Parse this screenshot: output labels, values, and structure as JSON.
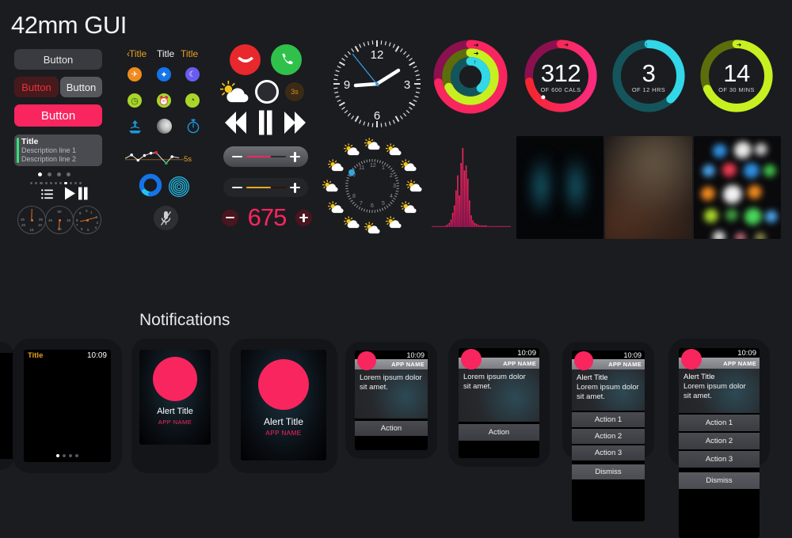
{
  "page": {
    "title": "42mm GUI",
    "notifications_title": "Notifications",
    "background": "#1b1c20",
    "accent_pink": "#f9255f",
    "accent_orange": "#e8a020"
  },
  "buttons": {
    "wide": "Button",
    "danger": "Button",
    "plain": "Button",
    "pink": "Button"
  },
  "description_card": {
    "title": "Title",
    "line1": "Description line 1",
    "line2": "Description line 2",
    "bar_color": "#36e07a"
  },
  "pager": {
    "big_dots": 4,
    "big_active": 0,
    "small_dots": 11,
    "small_active": 7
  },
  "media_small": {
    "list_icon": "list-icon",
    "play_icon": "play-icon",
    "pause_icon": "pause-icon"
  },
  "gauges": [
    {
      "name": "stopwatch-minutes",
      "numbers": [
        "25",
        "05",
        "20",
        "10",
        "15"
      ]
    },
    {
      "name": "stopwatch-seconds",
      "numbers": [
        "60",
        "45",
        "15",
        "30"
      ]
    },
    {
      "name": "stopwatch-hours",
      "numbers": [
        "0",
        "1",
        "2",
        "3",
        "4",
        "5",
        "6",
        "7",
        "8",
        "9"
      ]
    }
  ],
  "nav": {
    "back": "Title",
    "back_chevron": "‹",
    "middle": "Title",
    "right": "Title"
  },
  "icon_grid": [
    {
      "name": "airplane-mode-icon",
      "glyph": "✈",
      "bg": "#f08a1e",
      "fg": "#ffffff"
    },
    {
      "name": "bluetooth-icon",
      "glyph": "ᛒ",
      "bg": "#1474e8",
      "fg": "#ffffff"
    },
    {
      "name": "do-not-disturb-icon",
      "glyph": "☾",
      "bg": "#6a5cf0",
      "fg": "#ffffff"
    },
    {
      "name": "stopwatch-icon",
      "glyph": "◷",
      "bg": "#a8d62a",
      "fg": "#2b3b08"
    },
    {
      "name": "alarm-icon",
      "glyph": "⏰",
      "bg": "#a8d62a",
      "fg": "#2b3b08"
    },
    {
      "name": "timer-icon",
      "glyph": "⏱",
      "bg": "#a8d62a",
      "fg": "#2b3b08"
    },
    {
      "name": "airplay-icon",
      "glyph": "⇫",
      "bg": "transparent",
      "fg": "#1a9ae0"
    },
    {
      "name": "moon-phase-icon",
      "glyph": "🌓",
      "bg": "transparent",
      "fg": "#cccccc"
    },
    {
      "name": "timer-outline-icon",
      "glyph": "⏱",
      "bg": "transparent",
      "fg": "#1a9ae0"
    }
  ],
  "sparkline": {
    "label": "5s",
    "points": [
      {
        "x": 0,
        "y": 14,
        "dot": "none"
      },
      {
        "x": 11,
        "y": 8,
        "dot": "white"
      },
      {
        "x": 22,
        "y": 17,
        "dot": "white"
      },
      {
        "x": 33,
        "y": 9,
        "dot": "white"
      },
      {
        "x": 44,
        "y": 5,
        "dot": "white"
      },
      {
        "x": 53,
        "y": 4,
        "dot": "red"
      },
      {
        "x": 62,
        "y": 14,
        "dot": "none"
      },
      {
        "x": 70,
        "y": 22,
        "dot": "green"
      },
      {
        "x": 80,
        "y": 11,
        "dot": "white"
      },
      {
        "x": 92,
        "y": 13,
        "dot": "none"
      }
    ],
    "axis_color": "#8a5a1e",
    "line_color": "#dddddd"
  },
  "blue_widgets": {
    "progress_ring_label": "blue-progress-ring",
    "progress_percent": 78,
    "ripple_label": "ripple-icon",
    "mic_label": "mic-muted-icon"
  },
  "call": {
    "end_label": "end-call-button",
    "answer_label": "answer-call-button",
    "end_color": "#e8282d",
    "answer_color": "#2fc14a"
  },
  "shutter": {
    "weather_icon": "partly-cloudy-icon",
    "shutter_button": "camera-shutter-button",
    "timer_badge": "3s"
  },
  "transport": {
    "prev": "rewind-icon",
    "playpause": "pause-icon",
    "next": "fast-forward-icon"
  },
  "sliders": [
    {
      "name": "volume-slider",
      "fill_color": "#f9255f",
      "value": 62,
      "minus": "−",
      "plus": "+"
    },
    {
      "name": "brightness-slider",
      "fill_color": "#f0a81e",
      "value": 62,
      "minus": "−",
      "plus": "+"
    }
  ],
  "stepper": {
    "value": "675",
    "minus_label": "decrement-button",
    "plus_label": "increment-button",
    "color": "#f9255f"
  },
  "clock": {
    "numerals": [
      "12",
      "3",
      "6",
      "9"
    ],
    "hour_angle": 62,
    "minute_angle": -92,
    "second_angle": -23,
    "second_hand_color": "#2f9ee8"
  },
  "chart_data": {
    "type": "bar",
    "title": "",
    "name": "heart-rate-histogram",
    "color_top": "#f9255f",
    "color_bottom": "#c2185b",
    "values": [
      1,
      1,
      1,
      1,
      1,
      1,
      1,
      1,
      2,
      3,
      5,
      9,
      17,
      26,
      44,
      62,
      38,
      77,
      95,
      68,
      74,
      58,
      32,
      14,
      8,
      5,
      4,
      3,
      2,
      2,
      2,
      2,
      2,
      1,
      1,
      1,
      1,
      1,
      1,
      1,
      1,
      1,
      1,
      1,
      1,
      1,
      1
    ],
    "ylim": [
      0,
      100
    ],
    "grid": false
  },
  "activity_rings": {
    "combined": {
      "name": "activity-rings-combined",
      "rings": [
        {
          "name": "move-ring",
          "color": "#f9255f",
          "track": "#8c1050",
          "percent": 72,
          "icon": "→"
        },
        {
          "name": "exercise-ring",
          "color": "#c7f021",
          "track": "#5d6d0c",
          "percent": 68,
          "icon": "→)"
        },
        {
          "name": "stand-ring",
          "color": "#32d7e8",
          "track": "#14555c",
          "percent": 38,
          "icon": "↑"
        }
      ]
    },
    "cards": [
      {
        "name": "move-card",
        "value": "312",
        "unit": "OF 600 CALS",
        "color": "#f9255f",
        "track": "#8c1050",
        "percent": 72,
        "icon": "→"
      },
      {
        "name": "stand-card",
        "value": "3",
        "unit": "OF 12 HRS",
        "color": "#32d7e8",
        "track": "#14555c",
        "percent": 38,
        "icon": "↑"
      },
      {
        "name": "exercise-card",
        "value": "14",
        "unit": "OF 30 MINS",
        "color": "#c7f021",
        "track": "#5d6d0c",
        "percent": 68,
        "icon": "→)"
      }
    ]
  },
  "weather_clock": {
    "name": "weather-complication-clock",
    "hours": [
      "10",
      "11",
      "12",
      "1",
      "2",
      "3",
      "4",
      "5",
      "6",
      "7",
      "8",
      "9"
    ],
    "marker_color": "#2fa8e0",
    "icon": "partly-cloudy-icon",
    "icon_count": 12
  },
  "thumbnails": [
    {
      "name": "photo-thumbnail-butterfly"
    },
    {
      "name": "photo-thumbnail-blur"
    },
    {
      "name": "photo-thumbnail-app-grid"
    }
  ],
  "notifications": [
    {
      "name": "notification-short-look-empty",
      "kind": "status",
      "title": "Title",
      "time": "10:09",
      "dots": 4,
      "dots_active": 0
    },
    {
      "name": "notification-alert-small",
      "kind": "alert",
      "alert_title": "Alert Title",
      "app_name": "APP NAME"
    },
    {
      "name": "notification-alert-large",
      "kind": "alert",
      "alert_title": "Alert Title",
      "app_name": "APP NAME"
    },
    {
      "name": "notification-long-look-one-action-small",
      "kind": "long",
      "time": "10:09",
      "app_name": "APP NAME",
      "body": "Lorem ipsum dolor sit amet.",
      "actions": [
        "Action"
      ]
    },
    {
      "name": "notification-long-look-one-action-large",
      "kind": "long",
      "time": "10:09",
      "app_name": "APP NAME",
      "body": "Lorem ipsum dolor sit amet.",
      "actions": [
        "Action"
      ]
    },
    {
      "name": "notification-long-look-three-actions-small",
      "kind": "long",
      "time": "10:09",
      "app_name": "APP NAME",
      "alert_title": "Alert Title",
      "body": "Lorem ipsum dolor sit amet.",
      "actions": [
        "Action 1",
        "Action 2",
        "Action 3"
      ],
      "dismiss": "Dismiss"
    },
    {
      "name": "notification-long-look-three-actions-large",
      "kind": "long",
      "time": "10:09",
      "app_name": "APP NAME",
      "alert_title": "Alert Title",
      "body": "Lorem ipsum dolor sit amet.",
      "actions": [
        "Action 1",
        "Action 2",
        "Action 3"
      ],
      "dismiss": "Dismiss"
    }
  ]
}
